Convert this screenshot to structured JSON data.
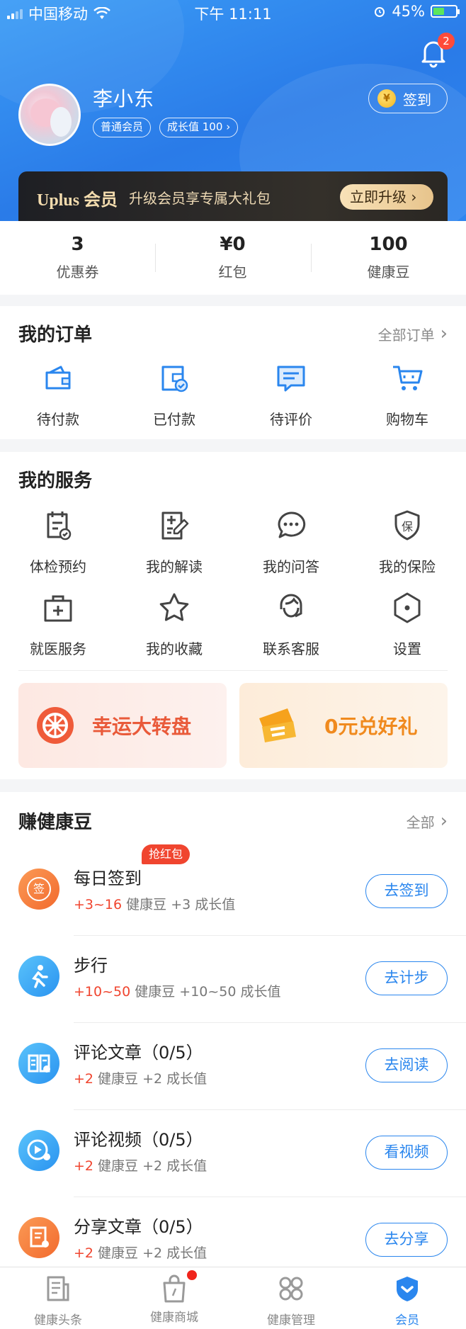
{
  "status_bar": {
    "carrier": "中国移动",
    "time": "下午 11:11",
    "battery": "45%"
  },
  "notifications": {
    "count": "2"
  },
  "profile": {
    "name": "李小东",
    "level_tag": "普通会员",
    "growth_tag": "成长值 100",
    "signin_label": "签到",
    "coin_symbol": "¥"
  },
  "vip": {
    "brand": "Uplus 会员",
    "desc": "升级会员享专属大礼包",
    "button": "立即升级"
  },
  "stats": [
    {
      "value": "3",
      "label": "优惠券"
    },
    {
      "value": "¥0",
      "label": "红包"
    },
    {
      "value": "100",
      "label": "健康豆"
    }
  ],
  "orders": {
    "title": "我的订单",
    "link": "全部订单",
    "items": [
      {
        "label": "待付款",
        "icon": "wallet-icon"
      },
      {
        "label": "已付款",
        "icon": "paid-wallet-icon"
      },
      {
        "label": "待评价",
        "icon": "comment-icon"
      },
      {
        "label": "购物车",
        "icon": "cart-icon"
      }
    ]
  },
  "services": {
    "title": "我的服务",
    "items": [
      {
        "label": "体检预约",
        "icon": "checkup-icon"
      },
      {
        "label": "我的解读",
        "icon": "report-edit-icon"
      },
      {
        "label": "我的问答",
        "icon": "chat-icon"
      },
      {
        "label": "我的保险",
        "icon": "insurance-shield-icon"
      },
      {
        "label": "就医服务",
        "icon": "medical-kit-icon"
      },
      {
        "label": "我的收藏",
        "icon": "star-icon"
      },
      {
        "label": "联系客服",
        "icon": "customer-service-icon"
      },
      {
        "label": "设置",
        "icon": "settings-icon"
      }
    ],
    "insurance_glyph": "保"
  },
  "promos": [
    {
      "title": "幸运大转盘",
      "color": "#e95a3a"
    },
    {
      "title": "0元兑好礼",
      "color": "#f08a1e"
    }
  ],
  "earn": {
    "title": "赚健康豆",
    "link": "全部",
    "hot_badge": "抢红包",
    "sign_glyph": "签",
    "tasks": [
      {
        "name": "每日签到",
        "reward_red": "+3~16",
        "reward_rest": " 健康豆 +3 成长值",
        "button": "去签到",
        "icon": "daily-signin-icon"
      },
      {
        "name": "步行",
        "reward_red": "+10~50",
        "reward_rest": " 健康豆 +10~50 成长值",
        "button": "去计步",
        "icon": "walking-icon"
      },
      {
        "name": "评论文章（0/5）",
        "reward_red": "+2",
        "reward_rest": " 健康豆 +2 成长值",
        "button": "去阅读",
        "icon": "article-icon"
      },
      {
        "name": "评论视频（0/5）",
        "reward_red": "+2",
        "reward_rest": " 健康豆 +2 成长值",
        "button": "看视频",
        "icon": "video-icon"
      },
      {
        "name": "分享文章（0/5）",
        "reward_red": "+2",
        "reward_rest": " 健康豆 +2 成长值",
        "button": "去分享",
        "icon": "share-article-icon"
      }
    ]
  },
  "tabbar": [
    {
      "label": "健康头条",
      "icon": "news-icon"
    },
    {
      "label": "健康商城",
      "icon": "shopping-bag-icon"
    },
    {
      "label": "健康管理",
      "icon": "grid-apps-icon"
    },
    {
      "label": "会员",
      "icon": "member-icon"
    }
  ],
  "colors": {
    "primary": "#2a86ee",
    "accent_red": "#f0452f",
    "header_blue": "#3b9cf6"
  }
}
